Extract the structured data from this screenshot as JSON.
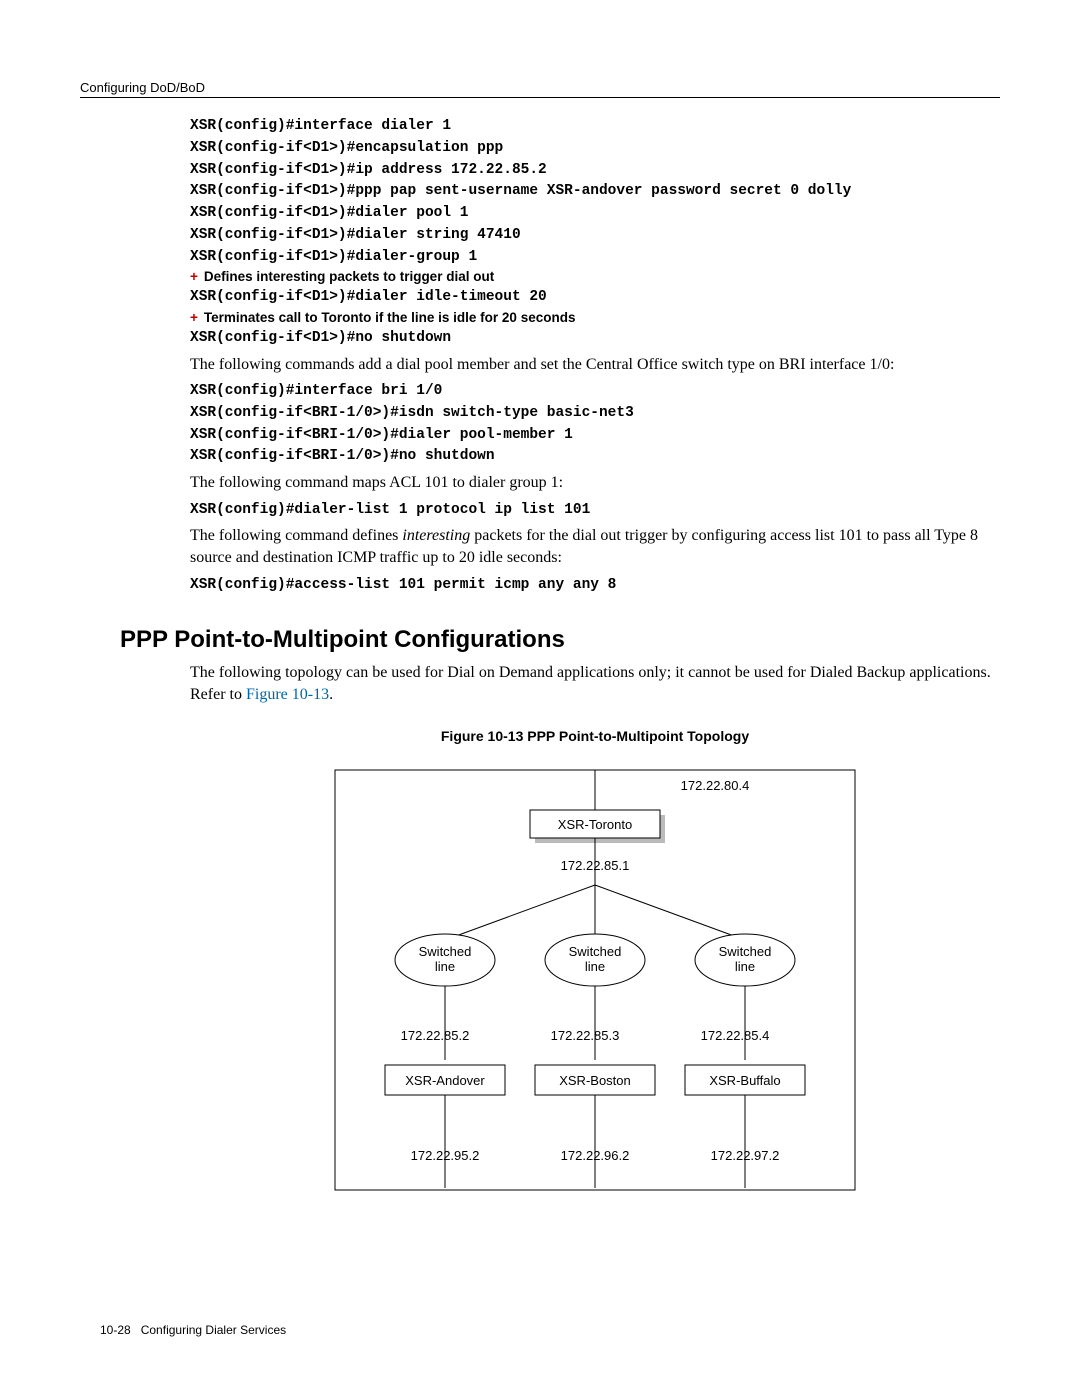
{
  "header": {
    "section": "Configuring DoD/BoD"
  },
  "code1": {
    "l1": "XSR(config)#interface dialer 1",
    "l2": "XSR(config-if<D1>)#encapsulation ppp",
    "l3": "XSR(config-if<D1>)#ip address 172.22.85.2",
    "l4": "XSR(config-if<D1>)#ppp pap sent-username XSR-andover password secret 0 dolly",
    "l5": "XSR(config-if<D1>)#dialer pool 1",
    "l6": "XSR(config-if<D1>)#dialer string 47410",
    "l7": "XSR(config-if<D1>)#dialer-group 1"
  },
  "anno1": "Defines interesting packets to trigger dial out",
  "code2": {
    "l1": "XSR(config-if<D1>)#dialer idle-timeout 20"
  },
  "anno2": "Terminates call to Toronto if the line is idle for 20 seconds",
  "code3": {
    "l1": "XSR(config-if<D1>)#no shutdown"
  },
  "para1": "The following commands add a dial pool member and set the Central Office switch type on BRI interface 1/0:",
  "code4": {
    "l1": "XSR(config)#interface bri 1/0",
    "l2": "XSR(config-if<BRI-1/0>)#isdn switch-type basic-net3",
    "l3": "XSR(config-if<BRI-1/0>)#dialer pool-member 1",
    "l4": "XSR(config-if<BRI-1/0>)#no shutdown"
  },
  "para2": "The following command maps ACL 101 to dialer group 1:",
  "code5": {
    "l1": "XSR(config)#dialer-list 1 protocol ip list 101"
  },
  "para3a": "The following command defines ",
  "para3i": "interesting",
  "para3b": " packets for the dial out trigger by configuring access list 101 to pass all Type 8 source and destination ICMP traffic up to 20 idle seconds:",
  "code6": {
    "l1": "XSR(config)#access-list 101 permit icmp any any 8"
  },
  "heading": "PPP Point-to-Multipoint Configurations",
  "para4a": "The following topology can be used for Dial on Demand applications only; it cannot be used for Dialed Backup applications. Refer to ",
  "para4link": "Figure 10-13",
  "para4b": ".",
  "figcaption": "Figure 10-13    PPP Point-to-Multipoint Topology",
  "fig": {
    "ip_top": "172.22.80.4",
    "top_router": "XSR-Toronto",
    "ip_hub": "172.22.85.1",
    "sw1": "Switched",
    "sw1b": "line",
    "sw2": "Switched",
    "sw2b": "line",
    "sw3": "Switched",
    "sw3b": "line",
    "ip_s1": "172.22.85.2",
    "ip_s2": "172.22.85.3",
    "ip_s3": "172.22.85.4",
    "r1": "XSR-Andover",
    "r2": "XSR-Boston",
    "r3": "XSR-Buffalo",
    "ip_b1": "172.22.95.2",
    "ip_b2": "172.22.96.2",
    "ip_b3": "172.22.97.2"
  },
  "footer": {
    "page": "10-28",
    "title": "Configuring Dialer Services"
  }
}
